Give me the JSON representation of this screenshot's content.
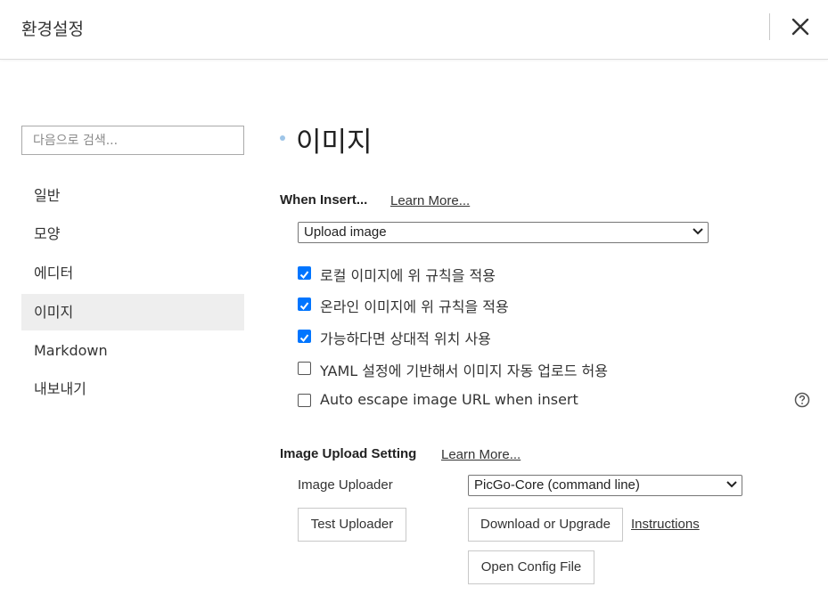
{
  "header": {
    "title": "환경설정",
    "close_icon": "close-icon"
  },
  "sidebar": {
    "search_placeholder": "다음으로 검색...",
    "items": [
      {
        "label": "일반",
        "active": false
      },
      {
        "label": "모양",
        "active": false
      },
      {
        "label": "에디터",
        "active": false
      },
      {
        "label": "이미지",
        "active": true
      },
      {
        "label": "Markdown",
        "active": false
      },
      {
        "label": "내보내기",
        "active": false
      }
    ]
  },
  "main": {
    "section_title": "이미지",
    "when_insert": {
      "heading": "When Insert...",
      "learn_more": "Learn More...",
      "select_value": "Upload image"
    },
    "options": [
      {
        "label": "로컬 이미지에 위 규칙을 적용",
        "checked": true
      },
      {
        "label": "온라인 이미지에 위 규칙을 적용",
        "checked": true
      },
      {
        "label": "가능하다면 상대적 위치 사용",
        "checked": true
      },
      {
        "label": "YAML 설정에 기반해서 이미지 자동 업로드 허용",
        "checked": false
      },
      {
        "label": "Auto escape image URL when insert",
        "checked": false
      }
    ],
    "upload": {
      "heading": "Image Upload Setting",
      "learn_more": "Learn More...",
      "uploader_label": "Image Uploader",
      "uploader_value": "PicGo-Core (command line)",
      "test_button": "Test Uploader",
      "download_button": "Download or Upgrade",
      "instructions_link": "Instructions",
      "open_config_button": "Open Config File"
    }
  },
  "colors": {
    "accent": "#0075ff",
    "active_bg": "#eeeeee",
    "dot": "#9ec5e8"
  }
}
